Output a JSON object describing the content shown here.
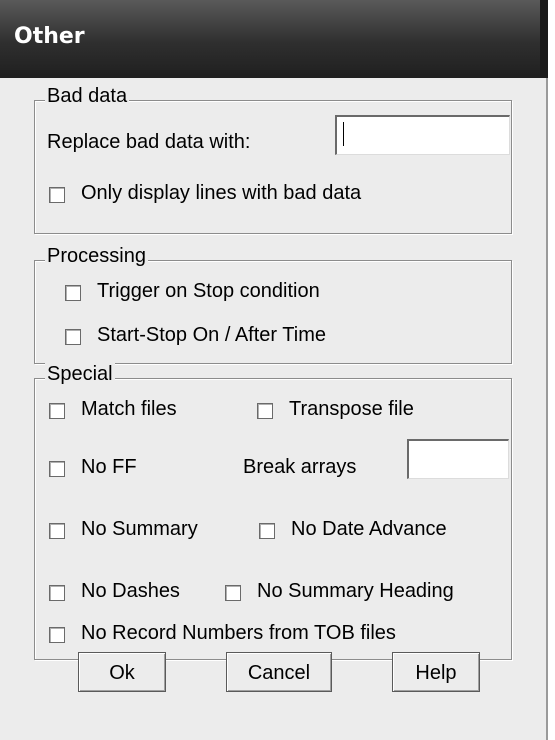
{
  "window": {
    "title": "Other"
  },
  "bad_data": {
    "legend": "Bad data",
    "replace_label": "Replace bad data with:",
    "replace_value": "",
    "only_display_label": "Only display lines with bad data"
  },
  "processing": {
    "legend": "Processing",
    "trigger_label": "Trigger on Stop condition",
    "start_stop_label": "Start-Stop  On / After Time"
  },
  "special": {
    "legend": "Special",
    "match_files": "Match files",
    "transpose_file": "Transpose file",
    "no_ff": "No FF",
    "break_arrays": "Break arrays",
    "break_arrays_value": "",
    "no_summary": "No Summary",
    "no_date_advance": "No Date Advance",
    "no_dashes": "No Dashes",
    "no_summary_heading": "No Summary Heading",
    "no_record_numbers": "No Record Numbers from TOB files"
  },
  "buttons": {
    "ok": "Ok",
    "cancel": "Cancel",
    "help": "Help"
  }
}
